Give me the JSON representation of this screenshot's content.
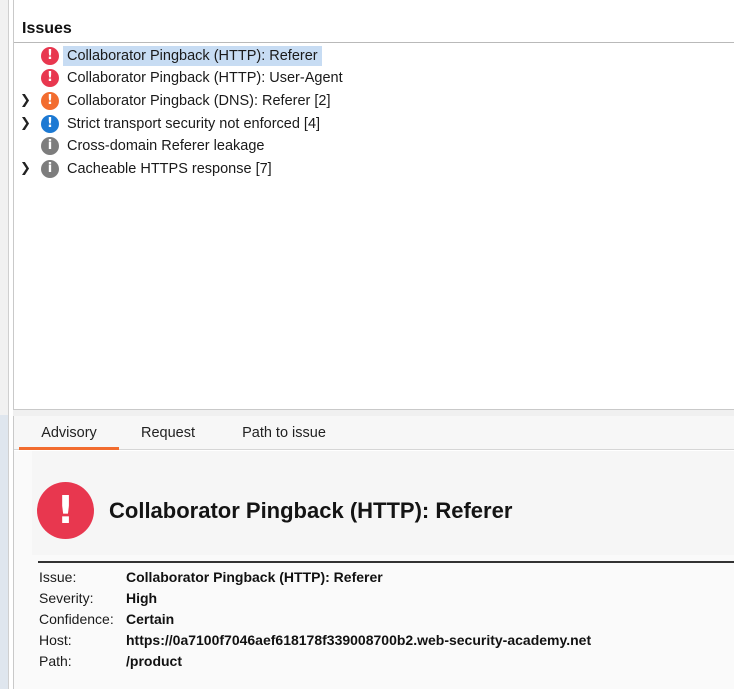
{
  "issues_panel": {
    "title": "Issues",
    "items": [
      {
        "label": "Collaborator Pingback (HTTP): Referer",
        "severity": "high",
        "icon": "exclamation-icon",
        "expandable": false,
        "selected": true
      },
      {
        "label": "Collaborator Pingback (HTTP): User-Agent",
        "severity": "high",
        "icon": "exclamation-icon",
        "expandable": false,
        "selected": false
      },
      {
        "label": "Collaborator Pingback (DNS): Referer [2]",
        "severity": "medium",
        "icon": "exclamation-icon",
        "expandable": true,
        "selected": false
      },
      {
        "label": "Strict transport security not enforced [4]",
        "severity": "low",
        "icon": "exclamation-icon",
        "expandable": true,
        "selected": false
      },
      {
        "label": "Cross-domain Referer leakage",
        "severity": "information",
        "icon": "info-icon",
        "expandable": false,
        "selected": false
      },
      {
        "label": "Cacheable HTTPS response [7]",
        "severity": "information",
        "icon": "info-icon",
        "expandable": true,
        "selected": false
      }
    ],
    "severity_colors": {
      "high": "#e8374f",
      "medium": "#f26c2f",
      "low": "#1c79d3",
      "information": "#7d7d7d"
    }
  },
  "detail_tabs": {
    "advisory": "Advisory",
    "request": "Request",
    "path_to_issue": "Path to issue",
    "active": "advisory",
    "accent_color": "#f26c2f"
  },
  "advisory": {
    "title": "Collaborator Pingback (HTTP): Referer",
    "icon": "exclamation-icon",
    "fields": [
      {
        "key": "Issue:",
        "value": "Collaborator Pingback (HTTP): Referer"
      },
      {
        "key": "Severity:",
        "value": "High"
      },
      {
        "key": "Confidence:",
        "value": "Certain"
      },
      {
        "key": "Host:",
        "value": "https://0a7100f7046aef618178f339008700b2.web-security-academy.net"
      },
      {
        "key": "Path:",
        "value": "/product"
      }
    ]
  }
}
